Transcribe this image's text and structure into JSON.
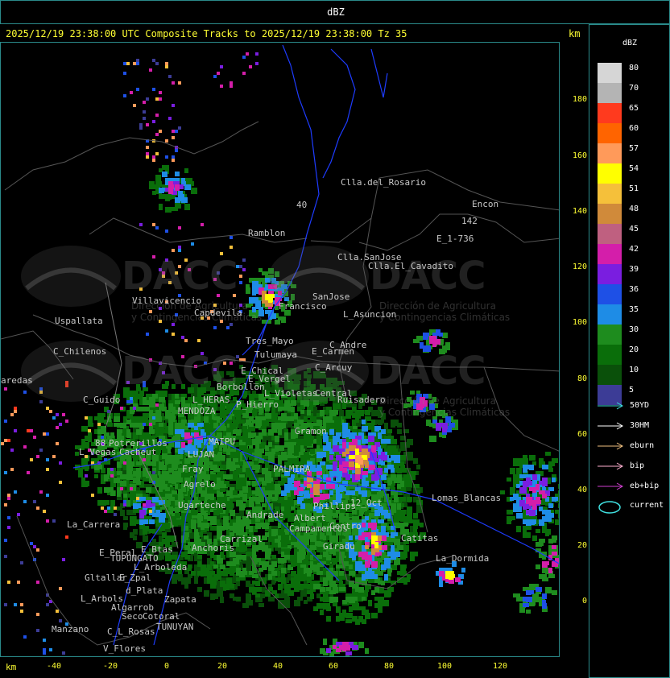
{
  "window": {
    "title": "dBZ"
  },
  "header": {
    "text": "2025/12/19 23:38:00 UTC Composite Tracks to 2025/12/19 23:38:00 Tz 35",
    "km_label": "km"
  },
  "axes": {
    "x_unit": "km",
    "y_unit": "km",
    "x_ticks": [
      "-40",
      "-20",
      "0",
      "20",
      "40",
      "60",
      "80",
      "100",
      "120"
    ],
    "y_ticks": [
      "180",
      "160",
      "140",
      "120",
      "100",
      "80",
      "60",
      "40",
      "20",
      "0"
    ]
  },
  "legend": {
    "title": "dBZ",
    "scale": [
      {
        "label": "80",
        "color": "#d6d6d6"
      },
      {
        "label": "70",
        "color": "#b4b4b4"
      },
      {
        "label": "65",
        "color": "#ff3a1e"
      },
      {
        "label": "60",
        "color": "#ff6400"
      },
      {
        "label": "57",
        "color": "#ff9a5a"
      },
      {
        "label": "54",
        "color": "#ffff00"
      },
      {
        "label": "51",
        "color": "#f5c03a"
      },
      {
        "label": "48",
        "color": "#d08a3a"
      },
      {
        "label": "45",
        "color": "#bf6080"
      },
      {
        "label": "42",
        "color": "#d41eaa"
      },
      {
        "label": "39",
        "color": "#7a1ee0"
      },
      {
        "label": "36",
        "color": "#1e50e6"
      },
      {
        "label": "35",
        "color": "#1e8ce6"
      },
      {
        "label": "30",
        "color": "#1e8c1e"
      },
      {
        "label": "20",
        "color": "#0a6e0a"
      },
      {
        "label": "10",
        "color": "#0a500a"
      },
      {
        "label": "5",
        "color": "#3c3c96"
      }
    ],
    "tracks": [
      {
        "label": "50YD",
        "color": "#40e0e0"
      },
      {
        "label": "30HM",
        "color": "#ffffff"
      },
      {
        "label": "eburn",
        "color": "#f0c080"
      },
      {
        "label": "bip",
        "color": "#ffb0d0"
      },
      {
        "label": "eb+bip",
        "color": "#d040d0"
      }
    ],
    "current_label": "current",
    "current_color": "#40e0e0"
  },
  "watermark": {
    "text": "DACC",
    "subtitle_line1": "Dirección de Agricultura",
    "subtitle_line2": "y Contingencias Climáticas"
  },
  "places": [
    {
      "name": "Clla.del_Rosario"
    },
    {
      "name": "Encon"
    },
    {
      "name": "142"
    },
    {
      "name": "E_1-736"
    },
    {
      "name": "Ramblon"
    },
    {
      "name": "Clla.SanJose"
    },
    {
      "name": "Clla.El_Cavadito"
    },
    {
      "name": "Villavicencio"
    },
    {
      "name": "Capdevila"
    },
    {
      "name": "SanJose"
    },
    {
      "name": "Francisco"
    },
    {
      "name": "L_Asuncion"
    },
    {
      "name": "Uspallata"
    },
    {
      "name": "Tres_Mayo"
    },
    {
      "name": "C_Andre"
    },
    {
      "name": "C_Chilenos"
    },
    {
      "name": "Tulumaya"
    },
    {
      "name": "E_Carmen"
    },
    {
      "name": "aredas"
    },
    {
      "name": "E_Chical"
    },
    {
      "name": "C_Arcuy"
    },
    {
      "name": "E_Vergel"
    },
    {
      "name": "Borbollon"
    },
    {
      "name": "L_Violetas"
    },
    {
      "name": "Central"
    },
    {
      "name": "Ruisadero"
    },
    {
      "name": "C_Guido"
    },
    {
      "name": "L_HERAS"
    },
    {
      "name": "P_Hierro"
    },
    {
      "name": "MENDOZA"
    },
    {
      "name": "Gramon"
    },
    {
      "name": "88"
    },
    {
      "name": "Potrerillos"
    },
    {
      "name": "Cacheut"
    },
    {
      "name": "L_Vegas"
    },
    {
      "name": "MAIPU"
    },
    {
      "name": "LUJAN"
    },
    {
      "name": "PALMIRA"
    },
    {
      "name": "Agrelo"
    },
    {
      "name": "Fray"
    },
    {
      "name": "Ugarteche"
    },
    {
      "name": "Phillips"
    },
    {
      "name": "12_Oct"
    },
    {
      "name": "Lomas_Blancas"
    },
    {
      "name": "La_Carrera"
    },
    {
      "name": "Andrade"
    },
    {
      "name": "Albert"
    },
    {
      "name": "Campamentos"
    },
    {
      "name": "Centro"
    },
    {
      "name": "Catitas"
    },
    {
      "name": "Carrizal"
    },
    {
      "name": "Anchoris"
    },
    {
      "name": "Giradu"
    },
    {
      "name": "E_Peral"
    },
    {
      "name": "E_Btas"
    },
    {
      "name": "TUPUNGATO"
    },
    {
      "name": "La_Dormida"
    },
    {
      "name": "L_Arboleda"
    },
    {
      "name": "Gltallar"
    },
    {
      "name": "E_Zpal"
    },
    {
      "name": "d_Plata"
    },
    {
      "name": "L_Arbols"
    },
    {
      "name": "Zapata"
    },
    {
      "name": "Algarrob"
    },
    {
      "name": "Seco"
    },
    {
      "name": "Cotoral"
    },
    {
      "name": "Manzano"
    },
    {
      "name": "C_L_Rosas"
    },
    {
      "name": "TUNUYAN"
    },
    {
      "name": "V_Flores"
    },
    {
      "name": "40"
    }
  ]
}
